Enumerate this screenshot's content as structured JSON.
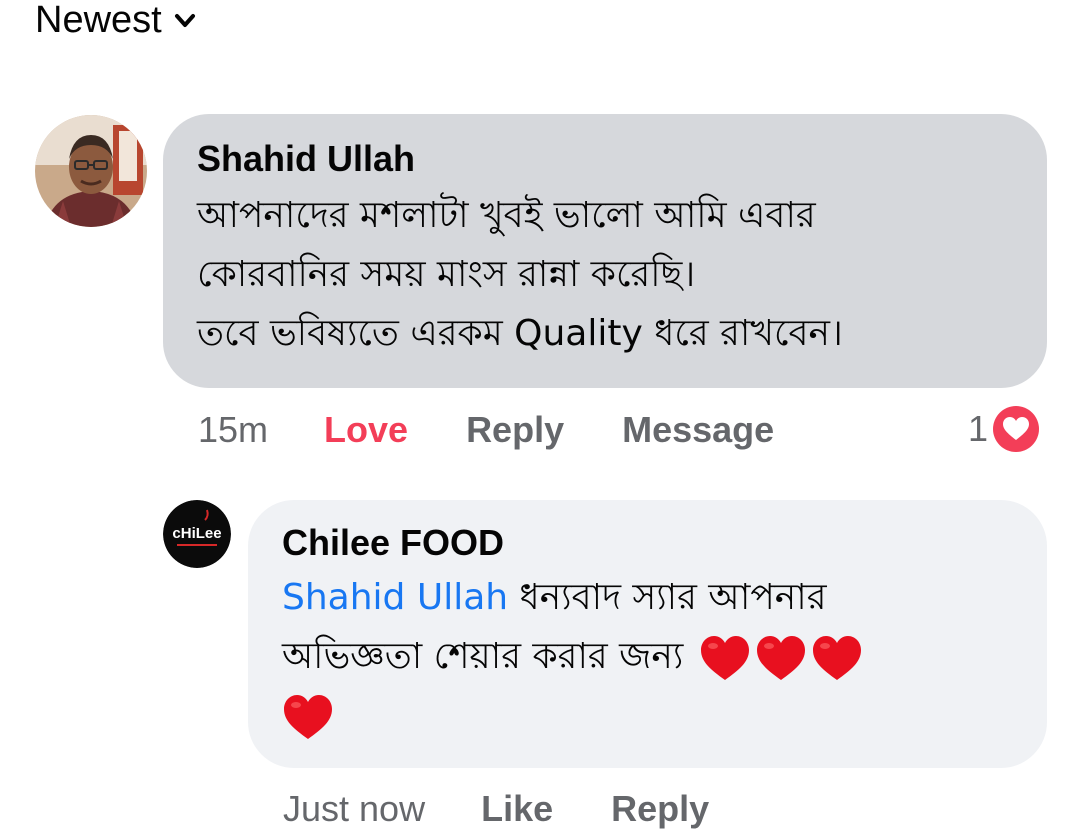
{
  "sort": {
    "label": "Newest",
    "icon": "chevron-down-icon"
  },
  "comments": [
    {
      "author": "Shahid Ullah",
      "lines": [
        "আপনাদের মশলাটা খুবই ভালো আমি এবার",
        "কোরবানির সময় মাংস রান্না করেছি।",
        "তবে ভবিষ্যতে এরকম Quality ধরে রাখবেন।"
      ],
      "time": "15m",
      "actions": {
        "love": "Love",
        "reply": "Reply",
        "message": "Message"
      },
      "reaction_count": "1",
      "reaction_icon": "heart-reaction-icon",
      "colors": {
        "bubble": "#d6d8dc",
        "love": "#f33e58",
        "reaction": "#f33e58"
      }
    }
  ],
  "reply": {
    "author": "Chilee FOOD",
    "mention": "Shahid Ullah",
    "line1_rest": " ধন্যবাদ স্যার আপনার",
    "line2": "অভিজ্ঞতা শেয়ার করার জন্য ",
    "hearts_inline": 3,
    "hearts_next_line": 1,
    "time": "Just now",
    "actions": {
      "like": "Like",
      "reply": "Reply"
    },
    "avatar_logo_text": "cHiLee",
    "colors": {
      "bubble": "#f0f2f5",
      "mention": "#1877f2",
      "heart": "#e8101f"
    }
  }
}
